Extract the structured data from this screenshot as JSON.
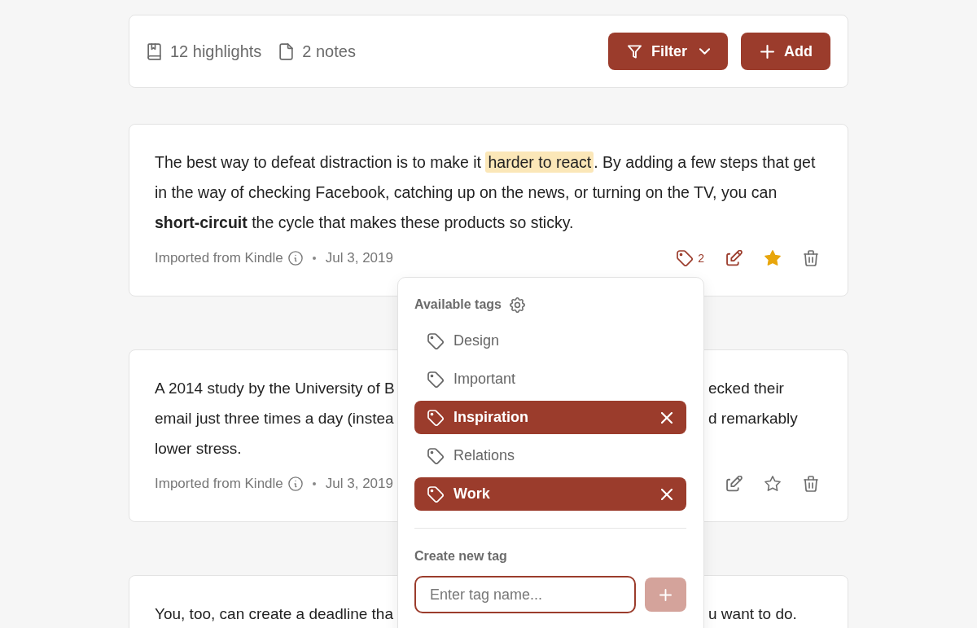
{
  "toolbar": {
    "stats": [
      {
        "kind": "highlights",
        "label": "12 highlights"
      },
      {
        "kind": "notes",
        "label": "2 notes"
      }
    ],
    "buttons": [
      {
        "kind": "filter",
        "label": "Filter"
      },
      {
        "kind": "add",
        "label": "Add"
      }
    ]
  },
  "cards": [
    {
      "kind": "full",
      "segments": [
        {
          "kind": "plain",
          "text": "The best way to defeat distraction is to make it "
        },
        {
          "kind": "highlight",
          "text": "harder to react"
        },
        {
          "kind": "plain",
          "text": ". By adding a few steps that get in the way of checking Facebook, catching up on the news, or turning on the TV, you can "
        },
        {
          "kind": "bold",
          "text": "short-circuit"
        },
        {
          "kind": "plain",
          "text": " the cycle that makes these products so sticky."
        }
      ],
      "source": "Imported from Kindle",
      "date": "Jul 3, 2019",
      "actions": [
        {
          "kind": "tag",
          "count": "2",
          "active": true
        },
        {
          "kind": "edit",
          "active": true
        },
        {
          "kind": "star",
          "active": true
        },
        {
          "kind": "delete",
          "active": false
        }
      ],
      "tag_menu": {
        "title": "Available tags",
        "tags": [
          {
            "label": "Design",
            "selected": false
          },
          {
            "label": "Important",
            "selected": false
          },
          {
            "label": "Inspiration",
            "selected": true
          },
          {
            "label": "Relations",
            "selected": false
          },
          {
            "label": "Work",
            "selected": true
          }
        ],
        "create_label": "Create new tag",
        "input": {
          "placeholder": "Enter tag name..."
        },
        "add_button": {
          "disabled": true
        }
      }
    },
    {
      "kind": "covered",
      "lines": [
        {
          "left": "A 2014 study by the University of B",
          "right": "ecked their"
        },
        {
          "left": "email just three times a day (instea",
          "right": "d remarkably"
        },
        {
          "left": "lower stress."
        }
      ],
      "source": "Imported from Kindle",
      "date": "Jul 3, 2019",
      "actions": [
        {
          "kind": "edit",
          "active": false
        },
        {
          "kind": "star",
          "active": false
        },
        {
          "kind": "delete",
          "active": false
        }
      ]
    },
    {
      "kind": "covered",
      "lines": [
        {
          "left": "You, too, can create a deadline tha",
          "right": "u want to do."
        }
      ]
    }
  ]
}
